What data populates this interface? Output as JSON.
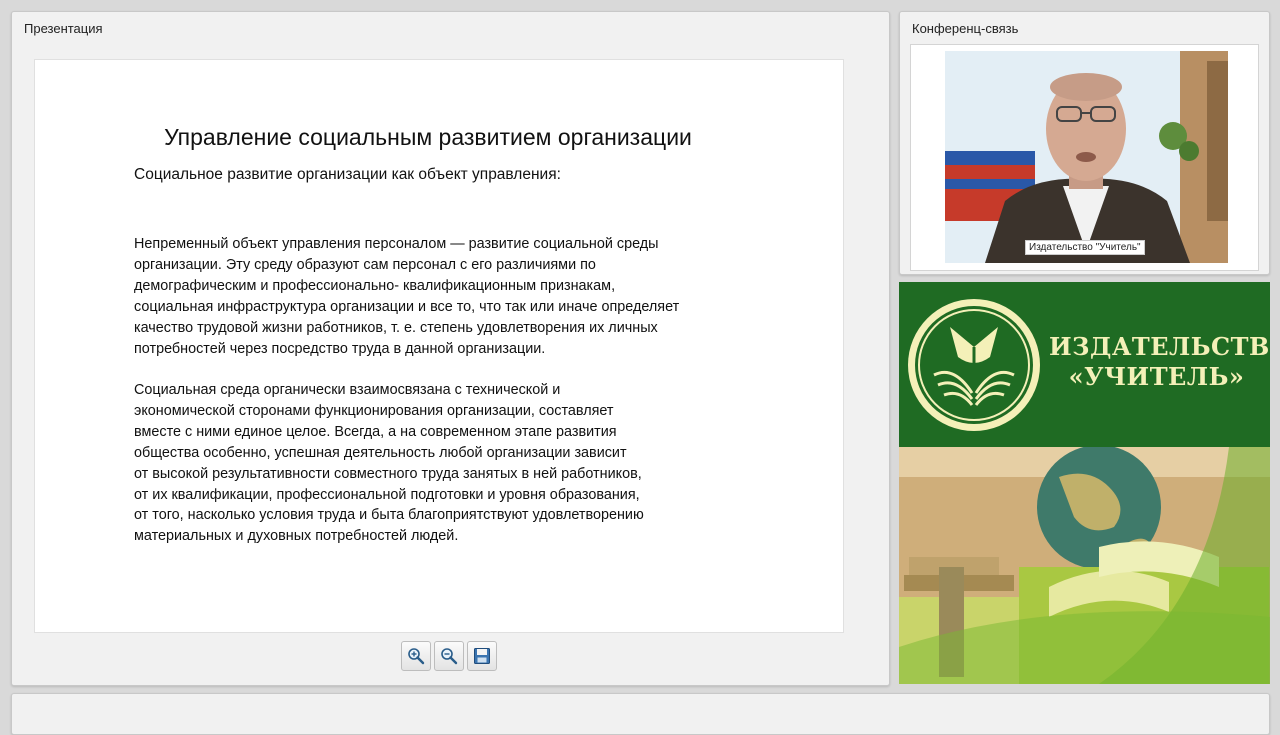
{
  "presentation": {
    "title": "Презентация",
    "slide": {
      "heading": "Управление социальным развитием организации",
      "subheading": "Социальное развитие организации как объект управления:",
      "paragraph1": "Непременный объект управления персоналом — развитие социальной среды\nорганизации. Эту среду образуют сам персонал с его различиями по\nдемографическим и профессионально- квалификационным признакам,\nсоциальная инфраструктура организации и все то, что так или иначе определяет\nкачество трудовой жизни работников, т. е. степень удовлетворения их личных\nпотребностей через посредство труда в данной организации.",
      "paragraph2": "Социальная среда органически взаимосвязана с технической и\nэкономической сторонами функционирования организации, составляет\nвместе с ними единое целое. Всегда, а на современном этапе развития\nобщества особенно, успешная деятельность любой организации зависит\nот высокой результативности совместного труда занятых в ней работников,\nот их квалификации, профессиональной подготовки и уровня образования,\nот того, насколько условия труда и быта благоприятствуют удовлетворению\nматериальных и духовных потребностей людей."
    },
    "toolbar": {
      "zoom_in_icon": "zoom-in-icon",
      "zoom_out_icon": "zoom-out-icon",
      "save_icon": "save-icon"
    }
  },
  "conference": {
    "title": "Конференц-связь",
    "caption": "Издательство \"Учитель\""
  },
  "banner": {
    "line1": "ИЗДАТЕЛЬСТВО",
    "line2": "«УЧИТЕЛЬ»"
  },
  "colors": {
    "banner_green": "#1f6b23",
    "banner_text": "#f4f0b8"
  }
}
